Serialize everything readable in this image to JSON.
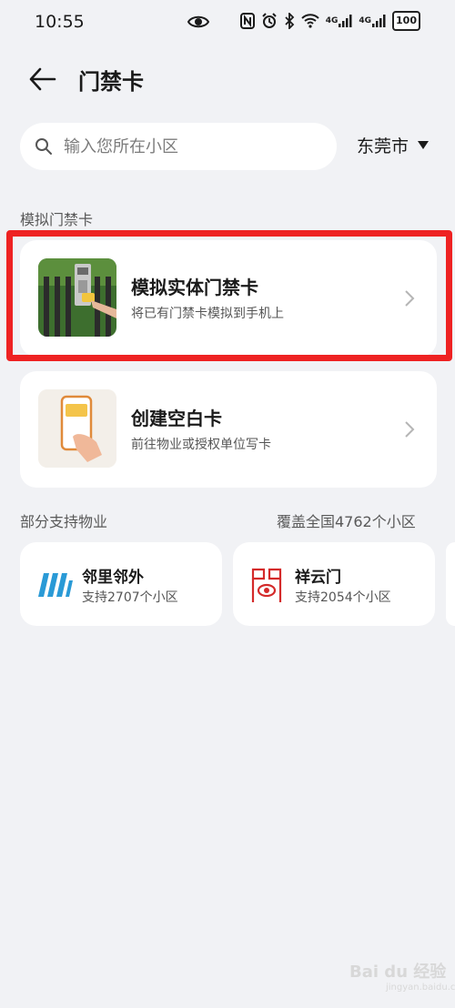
{
  "status_bar": {
    "time": "10:55",
    "network_label_1": "4G",
    "network_label_2": "4G",
    "battery": "100"
  },
  "header": {
    "title": "门禁卡"
  },
  "search": {
    "placeholder": "输入您所在小区",
    "value": ""
  },
  "city_select": {
    "value": "东莞市"
  },
  "section_simulate": {
    "label": "模拟门禁卡"
  },
  "cards": [
    {
      "title": "模拟实体门禁卡",
      "subtitle": "将已有门禁卡模拟到手机上",
      "icon": "door-access-photo-icon"
    },
    {
      "title": "创建空白卡",
      "subtitle": "前往物业或授权单位写卡",
      "icon": "phone-card-icon"
    }
  ],
  "section_properties": {
    "label": "部分支持物业",
    "coverage": "覆盖全国4762个小区"
  },
  "properties": [
    {
      "name": "邻里邻外",
      "count": "支持2707个小区",
      "icon": "linli-logo-icon"
    },
    {
      "name": "祥云门",
      "count": "支持2054个小区",
      "icon": "xiangyun-logo-icon"
    }
  ],
  "watermark": {
    "text": "Bai du 经验",
    "sub": "jingyan.baidu.com"
  },
  "colors": {
    "background": "#f1f2f5",
    "highlight": "#ee2222",
    "linli_blue": "#2a9ad6",
    "xiangyun_red": "#d42a2a"
  }
}
